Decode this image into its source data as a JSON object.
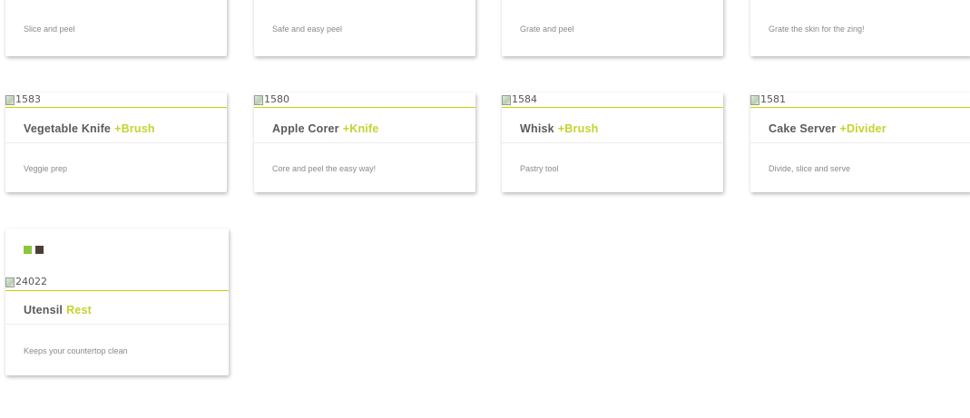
{
  "colors": {
    "accent": "#c5d32e",
    "swatch_green": "#8cc63f",
    "swatch_brown": "#4a3f38"
  },
  "top_row": [
    {
      "description": "Slice and peel"
    },
    {
      "description": "Safe and easy peel"
    },
    {
      "description": "Grate and peel"
    },
    {
      "description": "Grate the skin for the zing!"
    }
  ],
  "middle_row": [
    {
      "image_alt": "1583",
      "name": "Vegetable Knife",
      "accent": "+Brush",
      "description": "Veggie prep"
    },
    {
      "image_alt": "1580",
      "name": "Apple Corer",
      "accent": "+Knife",
      "description": "Core and peel the easy way!"
    },
    {
      "image_alt": "1584",
      "name": "Whisk",
      "accent": "+Brush",
      "description": "Pastry tool"
    },
    {
      "image_alt": "1581",
      "name": "Cake Server",
      "accent": "+Divider",
      "description": "Divide, slice and serve"
    }
  ],
  "bottom_card": {
    "image_alt": "24022",
    "name": "Utensil",
    "accent": "Rest",
    "description": "Keeps your countertop clean"
  }
}
